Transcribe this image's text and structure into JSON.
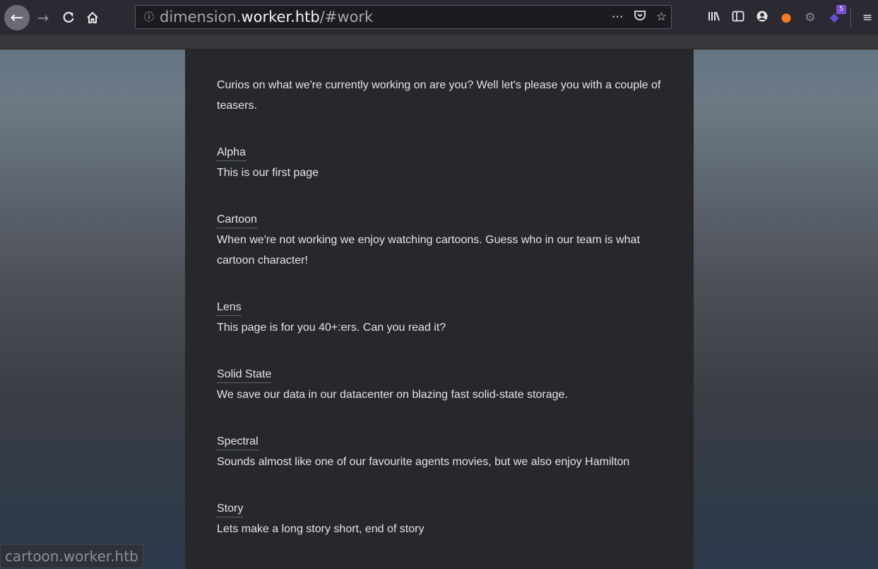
{
  "browser": {
    "url": {
      "subdomain": "dimension.",
      "host": "worker.htb",
      "path": "/#work"
    },
    "toolbar_icons": [
      "library-icon",
      "sidebar-icon",
      "account-icon",
      "foxy-proxy-icon",
      "wappalyzer-icon",
      "extension-icon"
    ],
    "extension_badge": "5",
    "status_url": "cartoon.worker.htb"
  },
  "page": {
    "intro": "Curios on what we're currently working on are you? Well let's please you with a couple of teasers.",
    "items": [
      {
        "title": "Alpha",
        "description": "This is our first page"
      },
      {
        "title": "Cartoon",
        "description": "When we're not working we enjoy watching cartoons. Guess who in our team is what cartoon character!"
      },
      {
        "title": "Lens",
        "description": "This page is for you 40+:ers. Can you read it?"
      },
      {
        "title": "Solid State",
        "description": "We save our data in our datacenter on blazing fast solid-state storage."
      },
      {
        "title": "Spectral",
        "description": "Sounds almost like one of our favourite agents movies, but we also enjoy Hamilton"
      },
      {
        "title": "Story",
        "description": "Lets make a long story short, end of story"
      }
    ]
  },
  "colors": {
    "panel": "#26282c",
    "chrome": "#2b2a33",
    "text": "#e2e4e8"
  }
}
